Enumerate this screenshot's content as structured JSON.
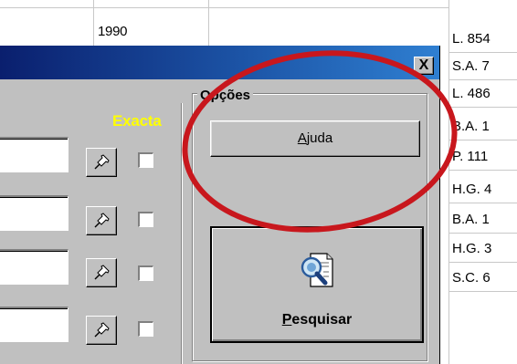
{
  "background_grid": {
    "cell_year": "1990"
  },
  "dialog": {
    "close_label": "X",
    "exacta_label": "Exacta",
    "options_group": {
      "title": "Opções",
      "help_prefix": "",
      "help_mnemonic": "A",
      "help_rest": "juda",
      "search_mnemonic": "P",
      "search_rest": "esquisar"
    },
    "icons": {
      "pin": "pushpin-icon",
      "search": "magnifier-document-icon"
    }
  },
  "right_list": {
    "items": [
      "L. 854",
      "S.A. 7",
      "L. 486",
      "B.A. 1",
      "P. 111",
      "H.G. 4",
      "B.A. 1",
      "H.G. 3",
      "S.C. 6"
    ]
  },
  "colors": {
    "title_bar_start": "#0a1f6e",
    "title_bar_end": "#2f7fd1",
    "dialog_bg": "#c0c0c0",
    "exacta": "#ffff00",
    "annotation": "#c8171d"
  }
}
